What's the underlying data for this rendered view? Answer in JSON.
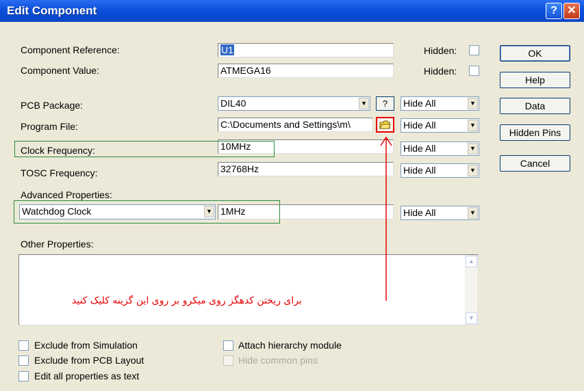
{
  "window": {
    "title": "Edit Component",
    "help_glyph": "?",
    "close_glyph": "✕"
  },
  "fields": {
    "component_reference": {
      "label": "Component Reference:",
      "value": "U1",
      "hidden_label": "Hidden:"
    },
    "component_value": {
      "label": "Component Value:",
      "value": "ATMEGA16",
      "hidden_label": "Hidden:"
    },
    "pcb_package": {
      "label": "PCB Package:",
      "value": "DIL40",
      "help_button": "?",
      "visibility": "Hide All"
    },
    "program_file": {
      "label": "Program File:",
      "value": "C:\\Documents and Settings\\m\\",
      "visibility": "Hide All"
    },
    "clock_frequency": {
      "label": "Clock Frequency:",
      "value": "10MHz",
      "visibility": "Hide All"
    },
    "tosc_frequency": {
      "label": "TOSC Frequency:",
      "value": "32768Hz",
      "visibility": "Hide All"
    },
    "advanced": {
      "label": "Advanced Properties:",
      "property": "Watchdog Clock",
      "value": "1MHz",
      "visibility": "Hide All"
    },
    "other_properties": {
      "label": "Other Properties:"
    }
  },
  "buttons": {
    "ok": "OK",
    "help": "Help",
    "data": "Data",
    "hidden_pins": "Hidden Pins",
    "cancel": "Cancel"
  },
  "checkboxes": {
    "exclude_simulation": "Exclude from Simulation",
    "exclude_pcb": "Exclude from PCB Layout",
    "edit_all_text": "Edit all properties as text",
    "attach_hierarchy": "Attach hierarchy module",
    "hide_common_pins": "Hide common pins"
  },
  "annotation": {
    "text": "برای ریختن کدهگز روی میکرو بر روی این گزینه کلیک کنید",
    "color": "#e60000"
  },
  "colors": {
    "title_bar": "#0b4fdb",
    "highlight_box": "#2b8a3e",
    "selection": "#316ac5",
    "annotation_arrow": "#e60000"
  }
}
